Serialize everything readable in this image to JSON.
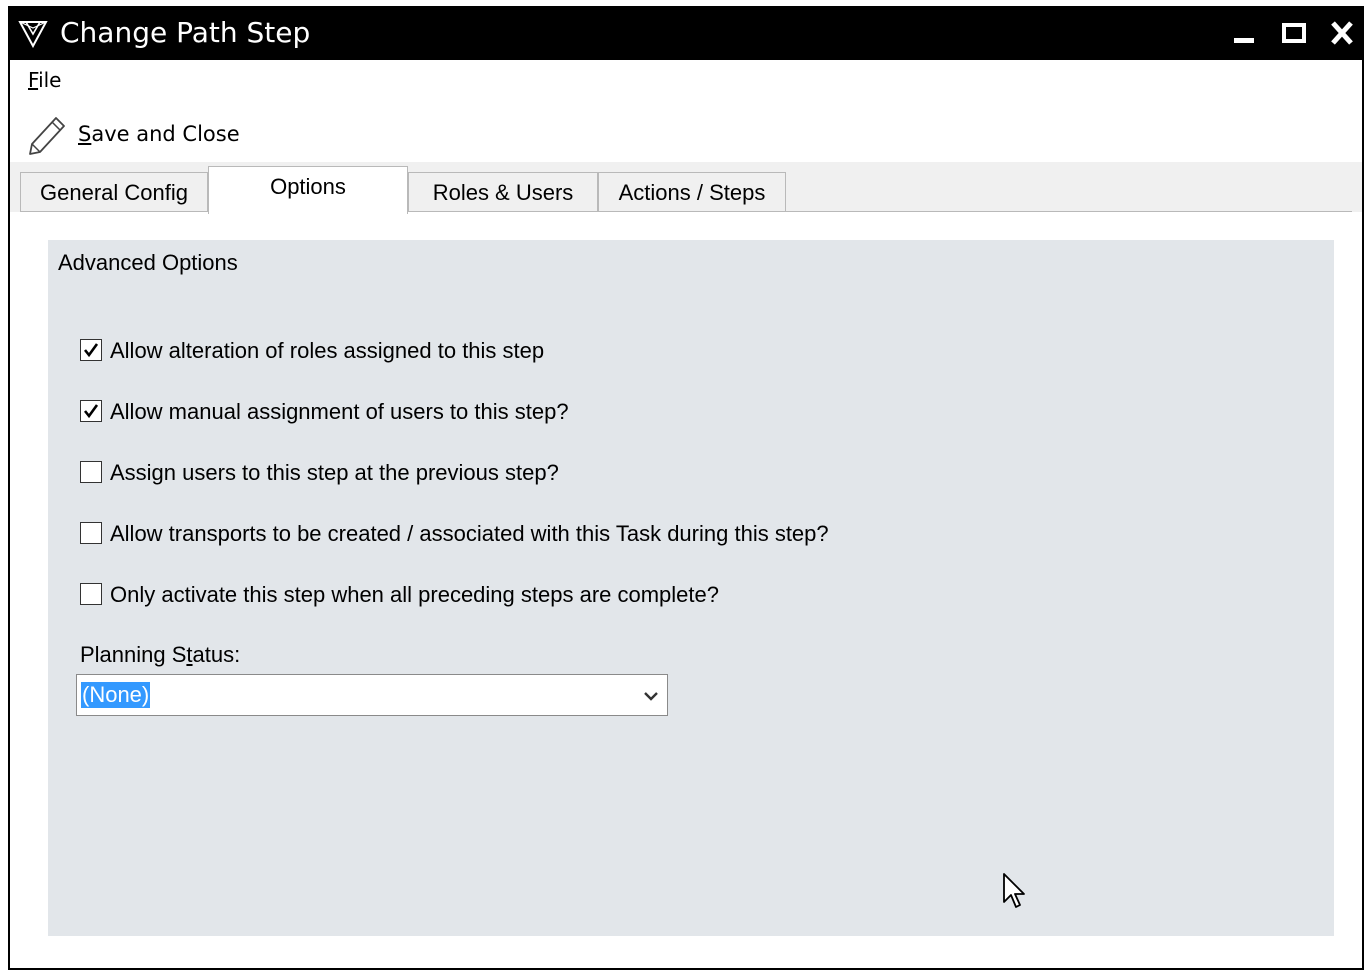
{
  "window": {
    "title": "Change Path Step",
    "controls": [
      "minimize",
      "maximize",
      "close"
    ]
  },
  "menu": {
    "file_rest": "ile",
    "file_mnemonic": "F"
  },
  "toolbar": {
    "save_mnemonic": "S",
    "save_rest": "ave and Close",
    "save_icon": "pencil-icon"
  },
  "tabs": [
    {
      "label": "General Config",
      "active": false
    },
    {
      "label": "Options",
      "active": true
    },
    {
      "label": "Roles & Users",
      "active": false
    },
    {
      "label": "Actions / Steps",
      "active": false
    }
  ],
  "advanced": {
    "title": "Advanced Options",
    "options": [
      {
        "label": "Allow alteration of roles assigned to this step",
        "checked": true
      },
      {
        "label": "Allow manual assignment of users to this step?",
        "checked": true
      },
      {
        "label": "Assign users to this step at the previous step?",
        "checked": false
      },
      {
        "label": "Allow transports to be created / associated with this Task during this step?",
        "checked": false
      },
      {
        "label": "Only activate this step when all preceding steps are complete?",
        "checked": false
      }
    ],
    "planning_label_pre": "Planning S",
    "planning_label_mnemonic": "t",
    "planning_label_post": "atus:",
    "planning_value": "(None)"
  },
  "colors": {
    "titlebar": "#000000",
    "group_bg": "#e2e6ea",
    "selection": "#3399ff"
  }
}
